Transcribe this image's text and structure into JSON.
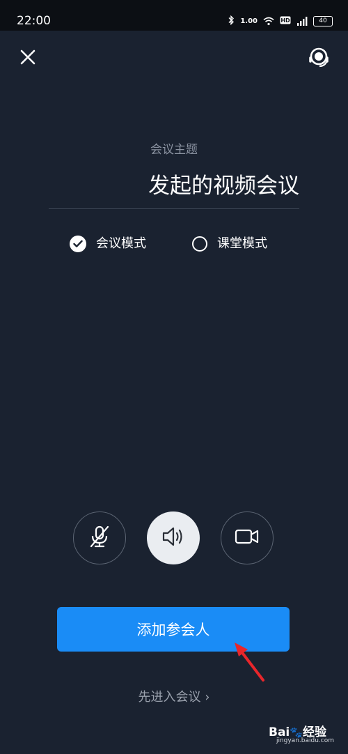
{
  "status_bar": {
    "time": "22:00",
    "speed": "1.00",
    "battery": "40"
  },
  "header": {
    "close_icon": "close-icon",
    "support_icon": "customer-service-icon"
  },
  "meeting": {
    "topic_label": "会议主题",
    "topic_value": "发起的视频会议"
  },
  "modes": [
    {
      "label": "会议模式",
      "selected": true
    },
    {
      "label": "课堂模式",
      "selected": false
    }
  ],
  "controls": {
    "mic": {
      "icon": "microphone-muted-icon",
      "state": "off"
    },
    "speaker": {
      "icon": "speaker-icon",
      "state": "on"
    },
    "camera": {
      "icon": "video-camera-icon",
      "state": "off"
    }
  },
  "actions": {
    "add_participants": "添加参会人",
    "enter_first": "先进入会议 ›"
  },
  "watermark": {
    "domain": "jingyan.baidu.com"
  },
  "colors": {
    "background": "#1a2230",
    "primary": "#1a8cf6",
    "annotation_arrow": "#e8262b"
  }
}
